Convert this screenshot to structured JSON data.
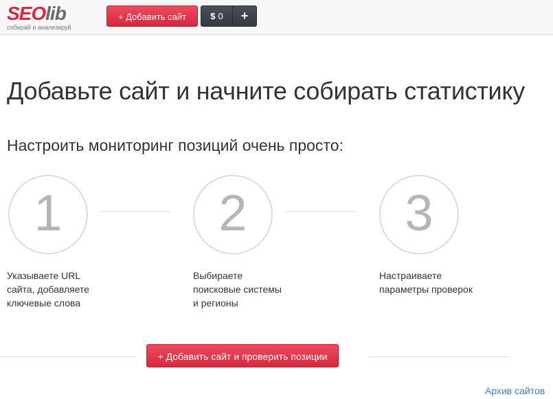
{
  "header": {
    "logo": {
      "seo": "SEO",
      "lib": "lib",
      "tagline": "собирай и анализируй"
    },
    "add_site_button": "+ Добавить сайт",
    "balance": {
      "currency_symbol": "$",
      "amount": "0",
      "add_icon": "+"
    }
  },
  "main": {
    "title": "Добавьте сайт и начните собирать статистику",
    "subtitle": "Настроить мониторинг позиций очень просто:",
    "steps": [
      {
        "number": "1",
        "lines": [
          "Указываете URL",
          "сайта, добавляете",
          "ключевые слова"
        ]
      },
      {
        "number": "2",
        "lines": [
          "Выбираете",
          "поисковые системы",
          "и регионы"
        ]
      },
      {
        "number": "3",
        "lines": [
          "Настраиваете",
          "параметры проверок"
        ]
      }
    ],
    "cta_button": "+ Добавить сайт и проверить позиции",
    "archive_link": "Архив сайтов"
  },
  "colors": {
    "brand_red": "#d8293e",
    "dark_button": "#3b3f46",
    "link_blue": "#3e7fc1"
  }
}
